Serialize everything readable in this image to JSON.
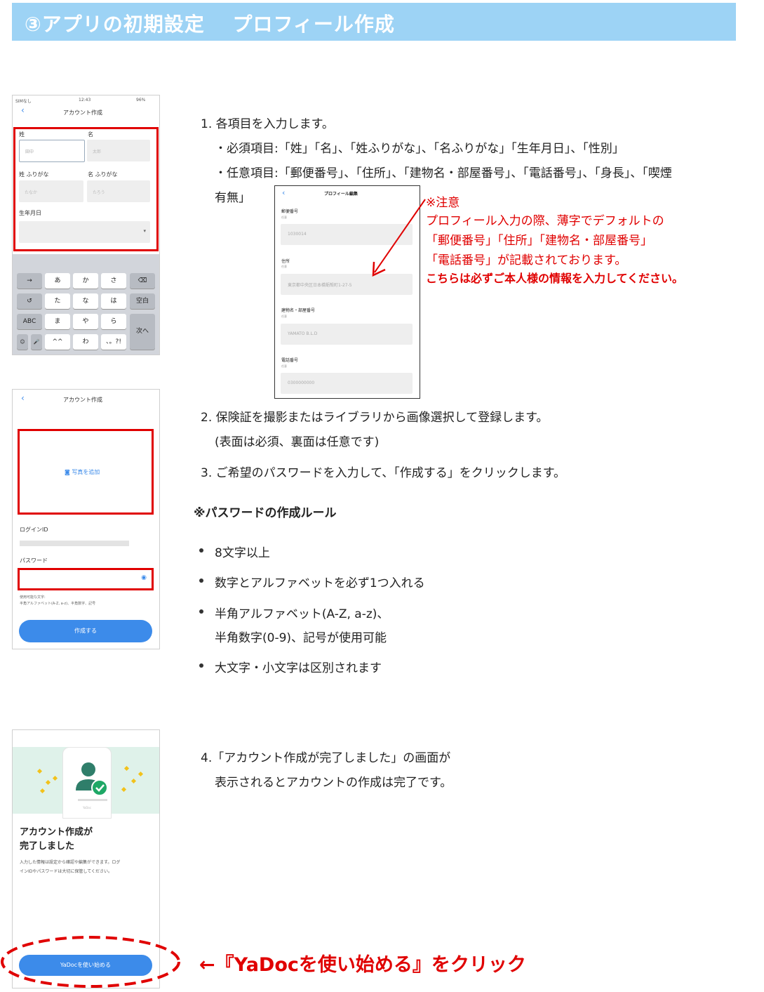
{
  "header": {
    "title": "③アプリの初期設定　 プロフィール作成"
  },
  "phone1": {
    "status_left": "SIMなし",
    "status_time": "12:43",
    "status_right": "96%",
    "title": "アカウント作成",
    "last_name_label": "姓",
    "first_name_label": "名",
    "last_name_placeholder": "田中",
    "first_name_placeholder": "太郎",
    "last_kana_label": "姓 ふりがな",
    "first_kana_label": "名 ふりがな",
    "last_kana_placeholder": "たなか",
    "first_kana_placeholder": "たろう",
    "birth_label": "生年月日",
    "keys": {
      "r1": [
        "→",
        "あ",
        "か",
        "さ",
        "⌫"
      ],
      "r2": [
        "↺",
        "た",
        "な",
        "は",
        "空白"
      ],
      "r3": [
        "ABC",
        "ま",
        "や",
        "ら",
        "次へ"
      ],
      "r4": [
        "☺",
        "🎤",
        "^^",
        "わ",
        "、。?!"
      ]
    }
  },
  "phone2": {
    "title": "アカウント作成",
    "add_photo": "写真を追加",
    "login_id_label": "ログインID",
    "password_label": "パスワード",
    "hint1": "使用可能な文字:",
    "hint2": "半角アルファベット(A-Z, a-z)、半角数字、記号",
    "create_button": "作成する"
  },
  "phone3": {
    "brand": "YaDoc",
    "title1": "アカウント作成が",
    "title2": "完了しました",
    "desc1": "入力した情報は設定から確認や編集ができます。ログ",
    "desc2": "インIDやパスワードは大切に保管してください。",
    "start_button": "YaDocを使い始める"
  },
  "profile_edit": {
    "title": "プロフィール編集",
    "optional": "任意",
    "postal_label": "郵便番号",
    "postal_value": "1030014",
    "address_label": "住所",
    "address_value": "東京都中央区日本橋蛎殻町1-27-5",
    "building_label": "建物名・部屋番号",
    "building_value": "YAMATO B.L.D",
    "phone_label": "電話番号",
    "phone_value": "0300000000"
  },
  "instructions": {
    "step1": "1. 各項目を入力します。",
    "required": "・必須項目:「姓」「名」、「姓ふりがな」、「名ふりがな」「生年月日」、「性別」",
    "optional": "・任意項目:「郵便番号」、「住所」、「建物名・部屋番号」、「電話番号」、「身長」、「喫煙",
    "optional_cont": "有無」",
    "step2": "2. 保険証を撮影またはライブラリから画像選択して登録します。",
    "step2_sub": "(表面は必須、裏面は任意です)",
    "step3": "3. ご希望のパスワードを入力して、「作成する」をクリックします。",
    "rules_title": "※パスワードの作成ルール",
    "rules": [
      "8文字以上",
      "数字とアルファベットを必ず1つ入れる",
      "半角アルファベット(A-Z, a-z)、",
      "大文字・小文字は区別されます"
    ],
    "rule3_cont": "半角数字(0-9)、記号が使用可能",
    "step4": "4.「アカウント作成が完了しました」の画面が",
    "step4_cont": "表示されるとアカウントの作成は完了です。"
  },
  "note": {
    "head": "※注意",
    "l1": "プロフィール入力の際、薄字でデフォルトの",
    "l2": "「郵便番号」「住所」「建物名・部屋番号」",
    "l3": "「電話番号」が記載されております。",
    "l4": "こちらは必ずご本人様の情報を入力してください。"
  },
  "callout": {
    "text": "←『YaDocを使い始める』をクリック"
  },
  "colors": {
    "header": "#9dd3f5",
    "red": "#e00000",
    "blue": "#3c8bea",
    "mint": "#dff2ea"
  }
}
